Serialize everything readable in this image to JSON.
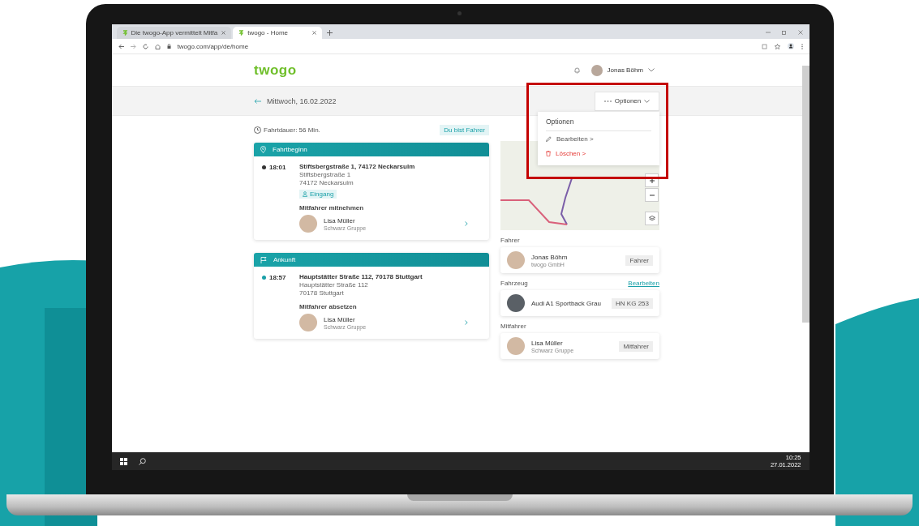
{
  "browser": {
    "tabs": [
      {
        "label": "Die twogo-App vermittelt Mitfa",
        "selected": false
      },
      {
        "label": "twogo - Home",
        "selected": true
      }
    ],
    "url": "twogo.com/app/de/home"
  },
  "header": {
    "logo": "twogo",
    "user": "Jonas Böhm"
  },
  "subheader": {
    "date": "Mittwoch, 16.02.2022",
    "options_button": "Optionen"
  },
  "options_menu": {
    "title": "Optionen",
    "items": [
      {
        "label": "Bearbeiten >",
        "kind": "edit"
      },
      {
        "label": "Löschen >",
        "kind": "delete"
      }
    ]
  },
  "trip": {
    "duration": "Fahrtdauer: 56 Min.",
    "role_badge": "Du bist Fahrer"
  },
  "stops": [
    {
      "kind": "start",
      "title": "Fahrtbeginn",
      "time": "18:01",
      "color": "#333333",
      "address": "Stiftsbergstraße 1, 74172 Neckarsulm",
      "street": "Stiftsbergstraße 1",
      "city": "74172 Neckarsulm",
      "tag": "Eingang",
      "passenger_action": "Mitfahrer mitnehmen",
      "passenger": {
        "name": "Lisa Müller",
        "group": "Schwarz Gruppe"
      }
    },
    {
      "kind": "end",
      "title": "Ankunft",
      "time": "18:57",
      "color": "#1aa0a8",
      "address": "Hauptstätter Straße 112, 70178 Stuttgart",
      "street": "Hauptstätter Straße 112",
      "city": "70178 Stuttgart",
      "passenger_action": "Mitfahrer absetzen",
      "passenger": {
        "name": "Lisa Müller",
        "group": "Schwarz Gruppe"
      }
    }
  ],
  "driver": {
    "heading": "Fahrer",
    "name": "Jonas Böhm",
    "company": "twogo GmbH",
    "badge": "Fahrer"
  },
  "vehicle": {
    "heading": "Fahrzeug",
    "edit_link": "Bearbeiten",
    "model": "Audi A1 Sportback Grau",
    "plate": "HN KG 253"
  },
  "passengers": {
    "heading": "Mitfahrer",
    "items": [
      {
        "name": "Lisa Müller",
        "group": "Schwarz Gruppe",
        "badge": "Mitfahrer"
      }
    ]
  },
  "taskbar": {
    "time": "10:25",
    "date": "27.01.2022"
  }
}
